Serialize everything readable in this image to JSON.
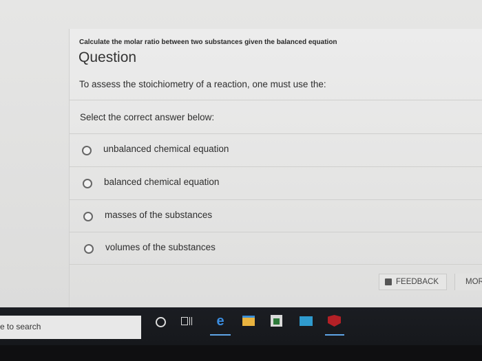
{
  "card": {
    "subtitle": "Calculate the molar ratio between two substances given the balanced equation",
    "title": "Question",
    "prompt": "To assess the stoichiometry of a reaction, one must use the:",
    "select_label": "Select the correct answer below:",
    "options": [
      {
        "label": "unbalanced chemical equation"
      },
      {
        "label": "balanced chemical equation"
      },
      {
        "label": "masses of the substances"
      },
      {
        "label": "volumes of the substances"
      }
    ],
    "feedback_label": "FEEDBACK",
    "more_label": "MOR"
  },
  "taskbar": {
    "search_text": "e to search",
    "icons": [
      "cortana-icon",
      "task-view-icon",
      "edge-icon",
      "file-explorer-icon",
      "store-icon",
      "mail-icon",
      "mcafee-icon"
    ]
  }
}
